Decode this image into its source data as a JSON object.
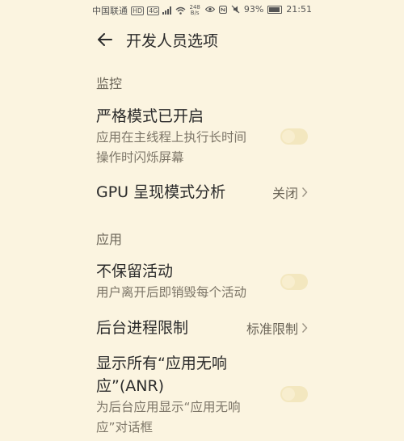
{
  "status_bar": {
    "carrier": "中国联通",
    "hd_badge": "HD",
    "signal_badge": "4G",
    "net_speed_value": "248",
    "net_speed_unit": "B/s",
    "battery_percent": "93%",
    "battery_level": 0.93,
    "time": "21:51"
  },
  "header": {
    "title": "开发人员选项"
  },
  "sections": {
    "monitor": "监控",
    "app": "应用"
  },
  "items": {
    "strict_mode": {
      "title": "严格模式已开启",
      "subtitle_line1": "应用在主线程上执行长时间",
      "subtitle_line2": "操作时闪烁屏幕",
      "enabled": false
    },
    "gpu_profile": {
      "title": "GPU 呈现模式分析",
      "value": "关闭"
    },
    "no_keep_activities": {
      "title": "不保留活动",
      "subtitle": "用户离开后即销毁每个活动",
      "enabled": false
    },
    "bg_limit": {
      "title": "后台进程限制",
      "value": "标准限制"
    },
    "show_anr": {
      "title_line1": "显示所有“应用无响",
      "title_line2": "应”(ANR)",
      "subtitle_line1": "为后台应用显示“应用无响",
      "subtitle_line2": "应”对话框",
      "enabled": false
    }
  },
  "colors": {
    "background": "#fbf4e0",
    "toggle_off": "#f3e7bf",
    "text_primary": "#2a2a2a",
    "text_secondary": "#7d7668"
  }
}
